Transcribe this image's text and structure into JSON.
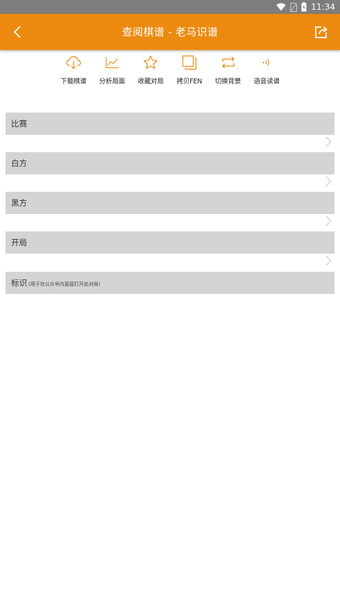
{
  "status_bar": {
    "time": "11:34",
    "icons": [
      "wifi-icon",
      "no-sim-icon",
      "battery-charging-icon"
    ]
  },
  "app_bar": {
    "title": "查阅棋谱 - 老马识谱",
    "back_icon": "back-arrow-icon",
    "share_icon": "share-icon",
    "color": "#ec8a10"
  },
  "toolbar": {
    "accent_color": "#ec8a10",
    "items": [
      {
        "label": "下载棋谱",
        "icon": "cloud-download-icon"
      },
      {
        "label": "分析局面",
        "icon": "line-chart-icon"
      },
      {
        "label": "收藏对局",
        "icon": "star-icon"
      },
      {
        "label": "拷贝FEN",
        "icon": "copy-icon"
      },
      {
        "label": "切换背景",
        "icon": "swap-icon"
      },
      {
        "label": "语音读谱",
        "icon": "sound-wave-icon"
      }
    ]
  },
  "sections": [
    {
      "label": "比赛",
      "hint": ""
    },
    {
      "label": "白方",
      "hint": ""
    },
    {
      "label": "黑方",
      "hint": ""
    },
    {
      "label": "开局",
      "hint": ""
    },
    {
      "label": "标识",
      "hint": "(用于在公众号内直接打开此对局)"
    }
  ]
}
